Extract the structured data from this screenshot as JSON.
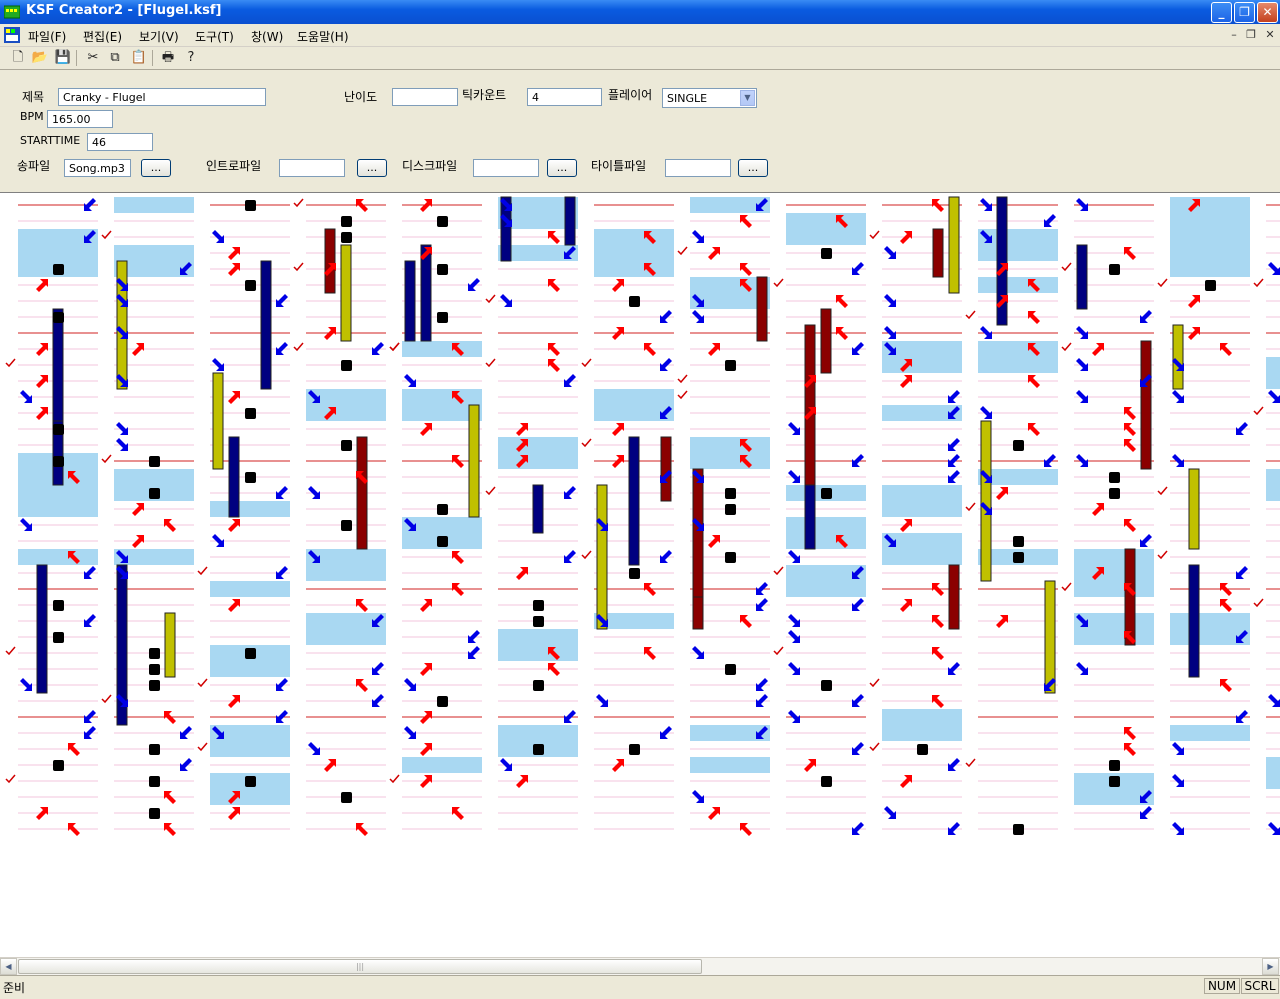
{
  "window": {
    "title": "KSF Creator2 - [Flugel.ksf]"
  },
  "menu": {
    "items": [
      "파일(F)",
      "편집(E)",
      "보기(V)",
      "도구(T)",
      "창(W)",
      "도움말(H)"
    ]
  },
  "form": {
    "title_label": "제목",
    "title_value": "Cranky - Flugel",
    "difficulty_label": "난이도",
    "difficulty_value": "",
    "tickcount_label": "틱카운트",
    "tickcount_value": "4",
    "player_label": "플레이어",
    "player_value": "SINGLE",
    "bpm_label": "BPM",
    "bpm_value": "165.00",
    "starttime_label": "STARTTIME",
    "starttime_value": "46",
    "song_label": "송파일",
    "song_value": "Song.mp3",
    "intro_label": "인트로파일",
    "intro_value": "",
    "disc_label": "디스크파일",
    "disc_value": "",
    "titlefile_label": "타이틀파일",
    "titlefile_value": "",
    "browse_label": "..."
  },
  "status": {
    "text": "준비",
    "num": "NUM",
    "scrl": "SCRL"
  },
  "colors": {
    "red_arrow": "#ff0000",
    "blue_arrow": "#0000e6",
    "hold_blue": "#000080",
    "hold_red": "#8b0000",
    "hold_yellow": "#c0c000",
    "highlight": "#a9d8f2",
    "center": "#000000"
  },
  "icons": [
    "new-icon",
    "open-icon",
    "save-icon",
    "cut-icon",
    "copy-icon",
    "paste-icon",
    "print-icon",
    "help-icon"
  ]
}
